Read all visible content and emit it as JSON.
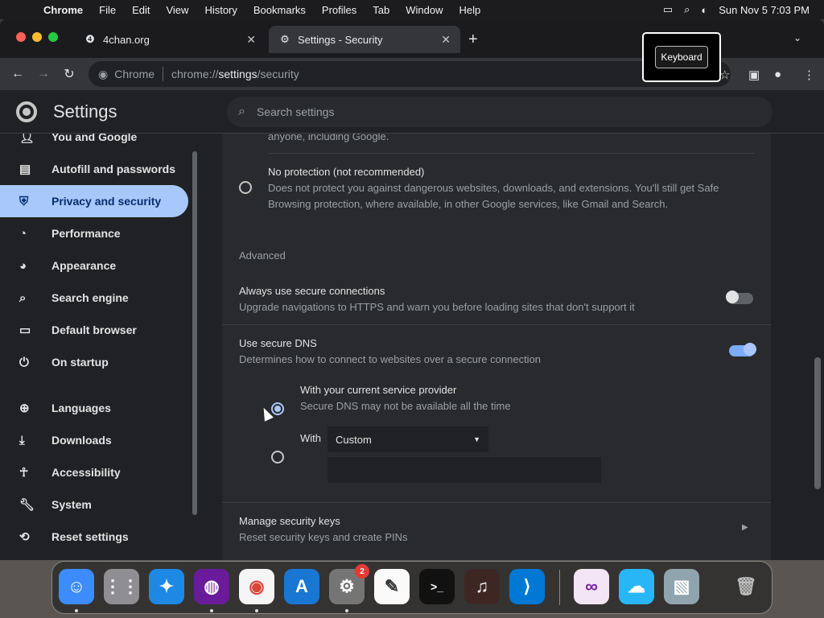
{
  "menubar": {
    "apple_icon": "apple-icon",
    "app_name": "Chrome",
    "items": [
      "File",
      "Edit",
      "View",
      "History",
      "Bookmarks",
      "Profiles",
      "Tab",
      "Window",
      "Help"
    ],
    "clock": "Sun Nov 5  7:03 PM"
  },
  "browser": {
    "tabs": [
      {
        "title": "4chan.org",
        "close": "✕"
      },
      {
        "title": "Settings - Security",
        "close": "✕"
      }
    ],
    "new_tab": "+",
    "omnibox": {
      "label": "Chrome",
      "url_scheme": "chrome://",
      "url_host": "settings",
      "url_path": "/security"
    },
    "keyboard_popup": "Keyboard"
  },
  "settings": {
    "title": "Settings",
    "search_placeholder": "Search settings",
    "nav": [
      {
        "label": "You and Google",
        "icon": "person-icon"
      },
      {
        "label": "Autofill and passwords",
        "icon": "clipboard-icon"
      },
      {
        "label": "Privacy and security",
        "icon": "shield-icon",
        "selected": true
      },
      {
        "label": "Performance",
        "icon": "speedometer-icon"
      },
      {
        "label": "Appearance",
        "icon": "palette-icon"
      },
      {
        "label": "Search engine",
        "icon": "search-icon"
      },
      {
        "label": "Default browser",
        "icon": "browser-icon"
      },
      {
        "label": "On startup",
        "icon": "power-icon"
      },
      {
        "label": "Languages",
        "icon": "globe-icon"
      },
      {
        "label": "Downloads",
        "icon": "download-icon"
      },
      {
        "label": "Accessibility",
        "icon": "accessibility-icon"
      },
      {
        "label": "System",
        "icon": "wrench-icon"
      },
      {
        "label": "Reset settings",
        "icon": "reset-icon"
      }
    ],
    "content": {
      "cut_text": "anyone, including Google.",
      "no_protection": {
        "title": "No protection (not recommended)",
        "desc_line1": "Does not protect you against dangerous websites, downloads, and extensions. You'll still get Safe",
        "desc_line2": "Browsing protection, where available, in other Google services, like Gmail and Search."
      },
      "advanced_heading": "Advanced",
      "secure_connections": {
        "title": "Always use secure connections",
        "desc": "Upgrade navigations to HTTPS and warn you before loading sites that don't support it",
        "enabled": false
      },
      "secure_dns": {
        "title": "Use secure DNS",
        "desc": "Determines how to connect to websites over a secure connection",
        "enabled": true,
        "option_current": {
          "title": "With your current service provider",
          "desc": "Secure DNS may not be available all the time",
          "selected": true
        },
        "option_with": {
          "label": "With",
          "select_value": "Custom",
          "selected": false
        }
      },
      "security_keys": {
        "title": "Manage security keys",
        "desc": "Reset security keys and create PINs"
      }
    }
  },
  "dock": {
    "apps": [
      {
        "name": "Finder",
        "icon": "finder-icon"
      },
      {
        "name": "Launchpad",
        "icon": "launchpad-icon"
      },
      {
        "name": "Safari",
        "icon": "safari-icon"
      },
      {
        "name": "Firefox",
        "icon": "firefox-icon"
      },
      {
        "name": "Chrome",
        "icon": "chrome-icon"
      },
      {
        "name": "App Store",
        "icon": "app-store-icon"
      },
      {
        "name": "System Settings",
        "icon": "system-settings-icon",
        "badge": "2"
      },
      {
        "name": "TextEdit",
        "icon": "textedit-icon"
      },
      {
        "name": "Terminal",
        "icon": "terminal-icon"
      },
      {
        "name": "GarageBand",
        "icon": "garageband-icon"
      },
      {
        "name": "Visual Studio Code",
        "icon": "vscode-icon"
      },
      {
        "name": "Visual Studio",
        "icon": "visual-studio-icon"
      },
      {
        "name": "Weather",
        "icon": "weather-icon"
      },
      {
        "name": "Preview",
        "icon": "preview-icon"
      },
      {
        "name": "Trash",
        "icon": "trash-icon"
      }
    ]
  },
  "colors": {
    "accent": "#a8c7fa",
    "background": "#202124",
    "card": "#292a2d"
  }
}
